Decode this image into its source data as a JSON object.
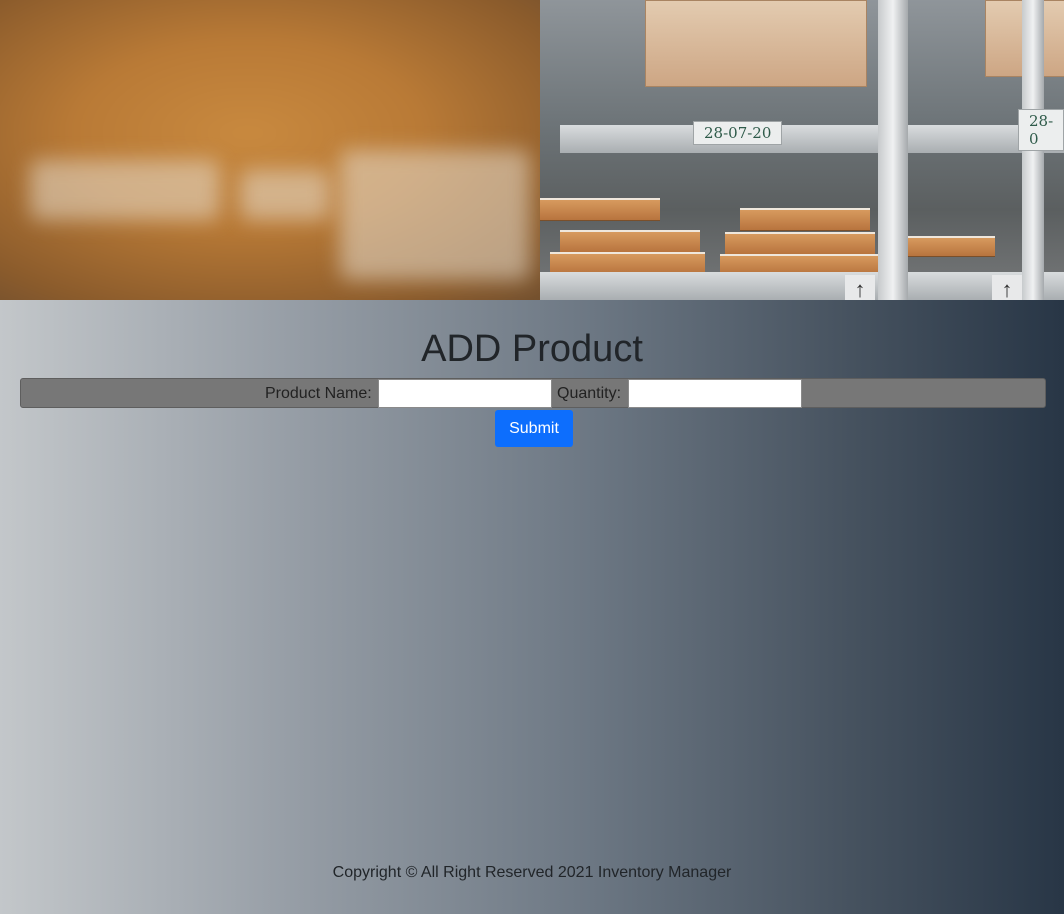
{
  "hero": {
    "shelf_labels": [
      "28-07-20",
      "28-0"
    ],
    "arrow_glyph": "↑"
  },
  "page": {
    "title": "ADD Product"
  },
  "form": {
    "product_name_label": "Product Name:",
    "product_name_value": "",
    "quantity_label": "Quantity:",
    "quantity_value": "",
    "submit_label": "Submit"
  },
  "footer": {
    "text": "Copyright © All Right Reserved 2021 Inventory Manager"
  },
  "colors": {
    "submit_button": "#0d6efd",
    "form_bar": "#777777",
    "background_gradient_start": "#c3c7ca",
    "background_gradient_end": "#283646"
  }
}
